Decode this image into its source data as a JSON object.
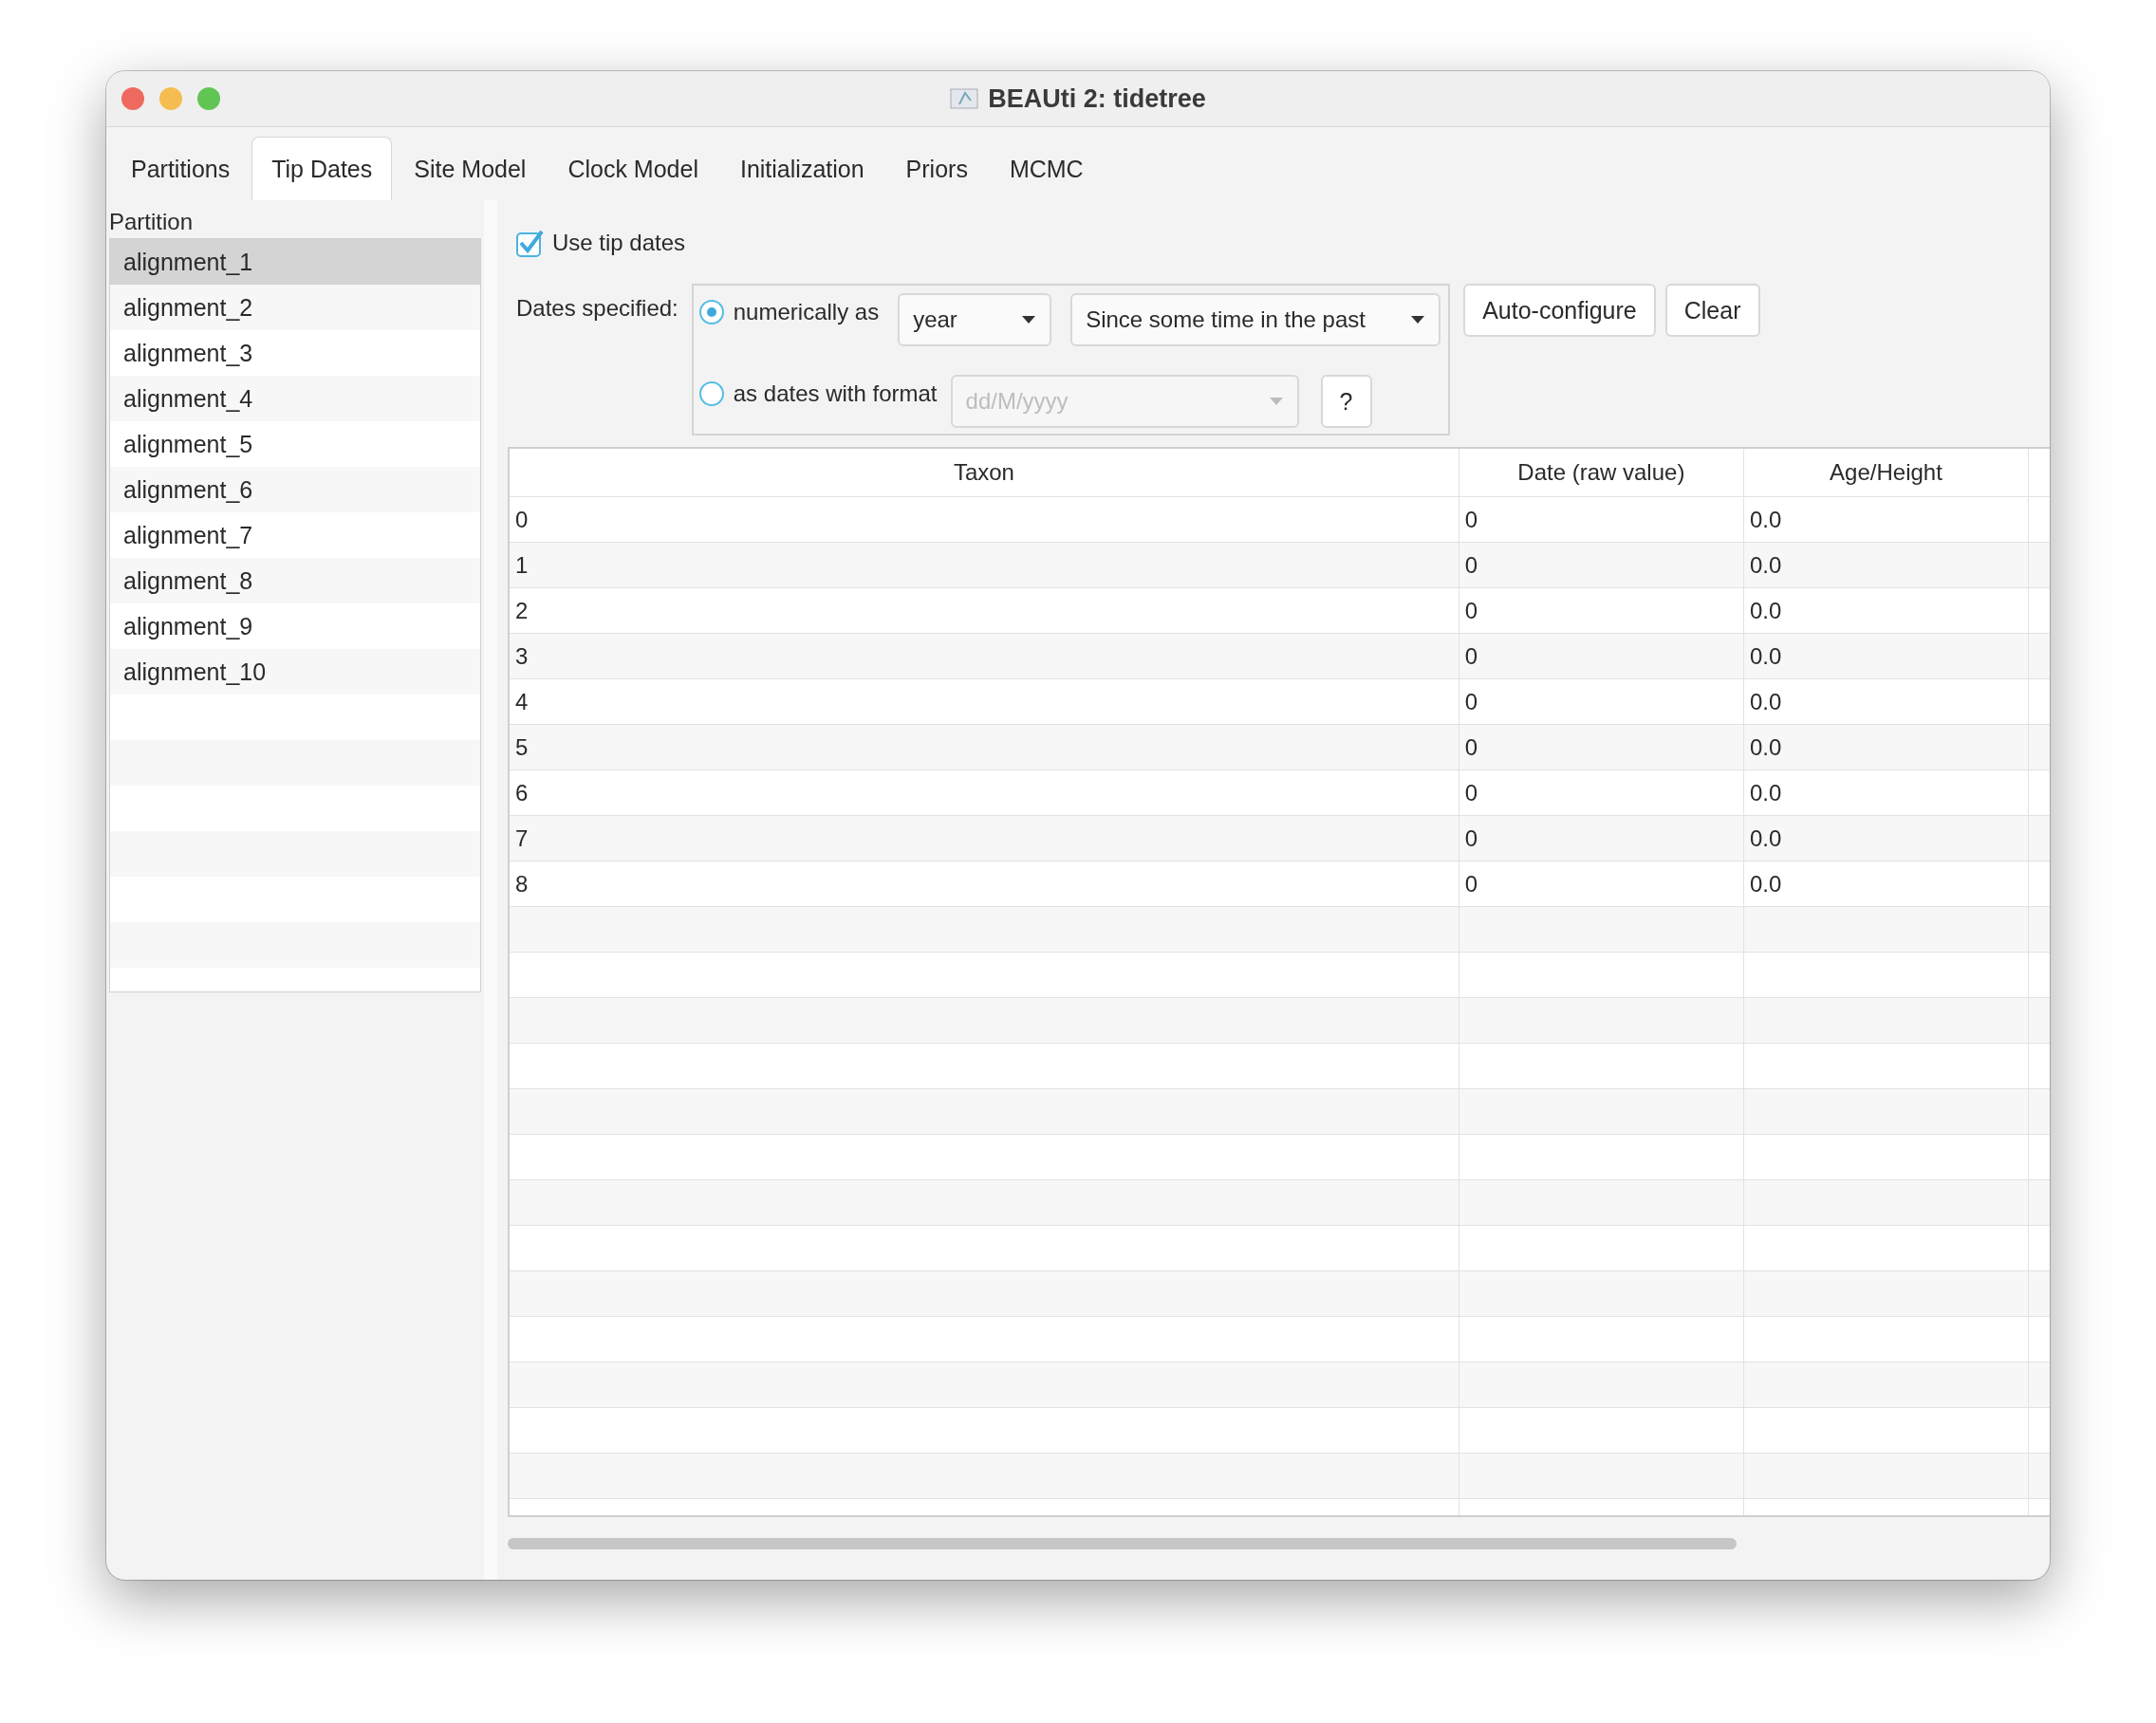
{
  "window": {
    "title": "BEAUti 2: tidetree"
  },
  "tabs": [
    {
      "label": "Partitions",
      "selected": false
    },
    {
      "label": "Tip Dates",
      "selected": true
    },
    {
      "label": "Site Model",
      "selected": false
    },
    {
      "label": "Clock Model",
      "selected": false
    },
    {
      "label": "Initialization",
      "selected": false
    },
    {
      "label": "Priors",
      "selected": false
    },
    {
      "label": "MCMC",
      "selected": false
    }
  ],
  "partition_list": {
    "header": "Partition",
    "items": [
      {
        "label": "alignment_1",
        "selected": true
      },
      {
        "label": "alignment_2",
        "selected": false
      },
      {
        "label": "alignment_3",
        "selected": false
      },
      {
        "label": "alignment_4",
        "selected": false
      },
      {
        "label": "alignment_5",
        "selected": false
      },
      {
        "label": "alignment_6",
        "selected": false
      },
      {
        "label": "alignment_7",
        "selected": false
      },
      {
        "label": "alignment_8",
        "selected": false
      },
      {
        "label": "alignment_9",
        "selected": false
      },
      {
        "label": "alignment_10",
        "selected": false
      }
    ]
  },
  "use_tip_dates": {
    "label": "Use tip dates",
    "checked": true
  },
  "dates_specified": {
    "label": "Dates specified:",
    "options": [
      {
        "kind": "numeric",
        "label": "numerically as",
        "selected": true,
        "unit": "year",
        "reference": "Since some time in the past"
      },
      {
        "kind": "format",
        "label": "as dates with format",
        "selected": false,
        "placeholder": "dd/M/yyyy",
        "disabled": true,
        "help": "?"
      }
    ]
  },
  "buttons": [
    "Auto-configure",
    "Clear"
  ],
  "table": {
    "columns": [
      "Taxon",
      "Date (raw value)",
      "Age/Height"
    ],
    "rows": [
      [
        "0",
        "0",
        "0.0"
      ],
      [
        "1",
        "0",
        "0.0"
      ],
      [
        "2",
        "0",
        "0.0"
      ],
      [
        "3",
        "0",
        "0.0"
      ],
      [
        "4",
        "0",
        "0.0"
      ],
      [
        "5",
        "0",
        "0.0"
      ],
      [
        "6",
        "0",
        "0.0"
      ],
      [
        "7",
        "0",
        "0.0"
      ],
      [
        "8",
        "0",
        "0.0"
      ]
    ]
  }
}
